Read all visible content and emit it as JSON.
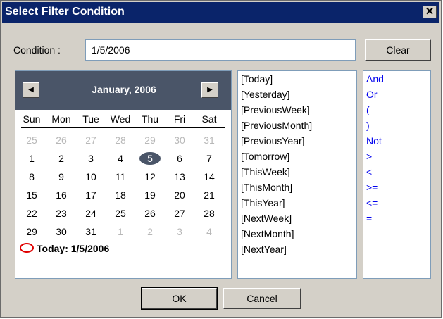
{
  "title": "Select Filter Condition",
  "condition": {
    "label": "Condition :",
    "value": "1/5/2006"
  },
  "buttons": {
    "clear": "Clear",
    "ok": "OK",
    "cancel": "Cancel"
  },
  "calendar": {
    "month": "January, 2006",
    "weekdays": [
      "Sun",
      "Mon",
      "Tue",
      "Wed",
      "Thu",
      "Fri",
      "Sat"
    ],
    "weeks": [
      [
        "25",
        "26",
        "27",
        "28",
        "29",
        "30",
        "31"
      ],
      [
        "1",
        "2",
        "3",
        "4",
        "5",
        "6",
        "7"
      ],
      [
        "8",
        "9",
        "10",
        "11",
        "12",
        "13",
        "14"
      ],
      [
        "15",
        "16",
        "17",
        "18",
        "19",
        "20",
        "21"
      ],
      [
        "22",
        "23",
        "24",
        "25",
        "26",
        "27",
        "28"
      ],
      [
        "29",
        "30",
        "31",
        "1",
        "2",
        "3",
        "4"
      ]
    ],
    "selected_day": "5",
    "today_label": "Today: 1/5/2006"
  },
  "date_keywords": [
    "[Today]",
    "[Yesterday]",
    "[PreviousWeek]",
    "[PreviousMonth]",
    "[PreviousYear]",
    "[Tomorrow]",
    "[ThisWeek]",
    "[ThisMonth]",
    "[ThisYear]",
    "[NextWeek]",
    "[NextMonth]",
    "[NextYear]"
  ],
  "operators": [
    "And",
    "Or",
    "(",
    ")",
    "Not",
    ">",
    "<",
    ">=",
    "<=",
    "="
  ],
  "colors": {
    "title_bar": "#0a246a",
    "calendar_header": "#4a5568",
    "operator_text": "#0000ee",
    "today_marker": "#e00000"
  }
}
